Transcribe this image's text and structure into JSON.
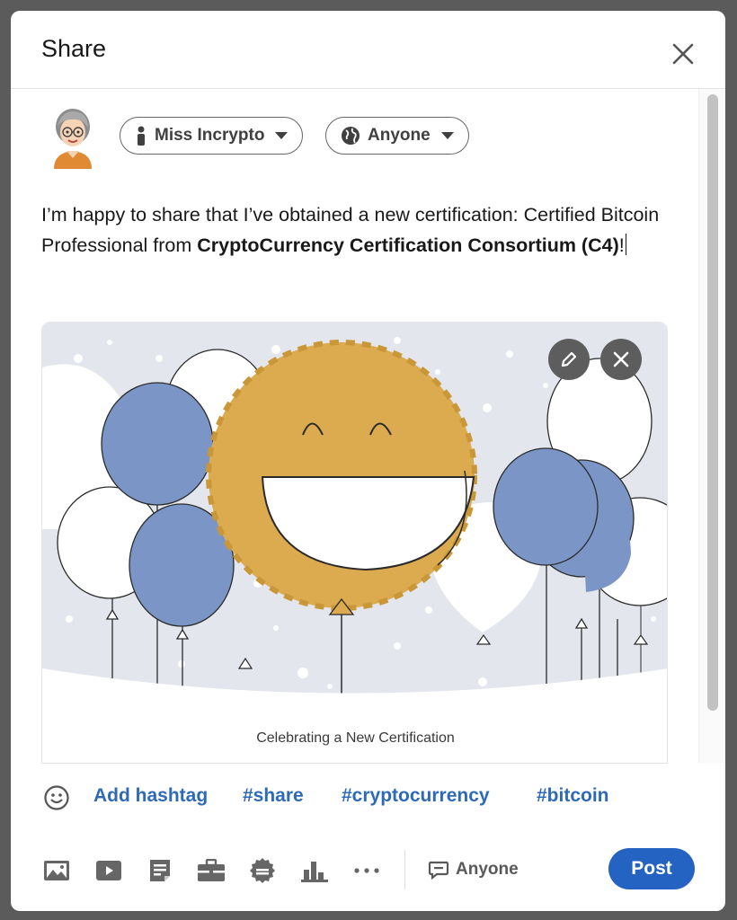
{
  "dialog": {
    "title": "Share"
  },
  "author": {
    "name": "Miss Incrypto",
    "visibility": "Anyone"
  },
  "post": {
    "text_part1": "I’m happy to share that I’ve obtained a new certification: Certified Bitcoin Professional from ",
    "text_bold": "CryptoCurrency Certification Consortium (C4)",
    "text_end": "!"
  },
  "media": {
    "caption": "Celebrating a New Certification"
  },
  "hashtags": {
    "add_label": "Add hashtag",
    "items": [
      "#share",
      "#cryptocurrency",
      "#bitcoin"
    ]
  },
  "toolbar": {
    "icons": [
      "photo-icon",
      "video-icon",
      "document-icon",
      "job-icon",
      "celebrate-icon",
      "poll-icon",
      "more-icon"
    ],
    "comment_visibility": "Anyone",
    "post_label": "Post"
  },
  "colors": {
    "accent": "#2563c3",
    "link": "#2e6ab8",
    "balloon_blue": "#7b96c6",
    "sun_gold": "#dcaa4f"
  }
}
